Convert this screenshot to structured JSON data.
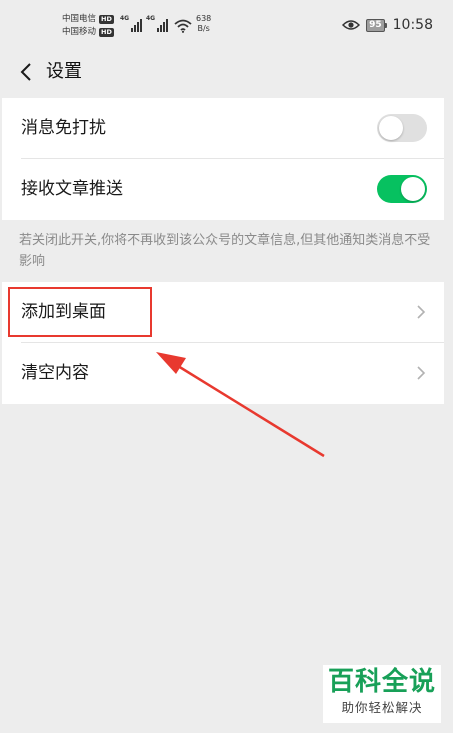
{
  "status_bar": {
    "carrier_1": "中国电信",
    "carrier_2": "中国移动",
    "hd_badge": "HD",
    "network_1": "4G",
    "network_2": "4G",
    "speed_value": "638",
    "speed_unit": "B/s",
    "battery": "95",
    "time": "10:58"
  },
  "nav": {
    "title": "设置"
  },
  "settings_group_1": {
    "items": [
      {
        "label": "消息免打扰",
        "toggle_on": false
      },
      {
        "label": "接收文章推送",
        "toggle_on": true
      }
    ]
  },
  "hint": {
    "text": "若关闭此开关,你将不再收到该公众号的文章信息,但其他通知类消息不受影响"
  },
  "settings_group_2": {
    "items": [
      {
        "label": "添加到桌面"
      },
      {
        "label": "清空内容"
      }
    ]
  },
  "watermark": {
    "main": "百科全说",
    "sub": "助你轻松解决"
  },
  "colors": {
    "accent_green": "#07c160",
    "toggle_off": "#e0e0e0",
    "annotation_red": "#e8392f",
    "background": "#ededed",
    "watermark_green": "#18a058"
  }
}
